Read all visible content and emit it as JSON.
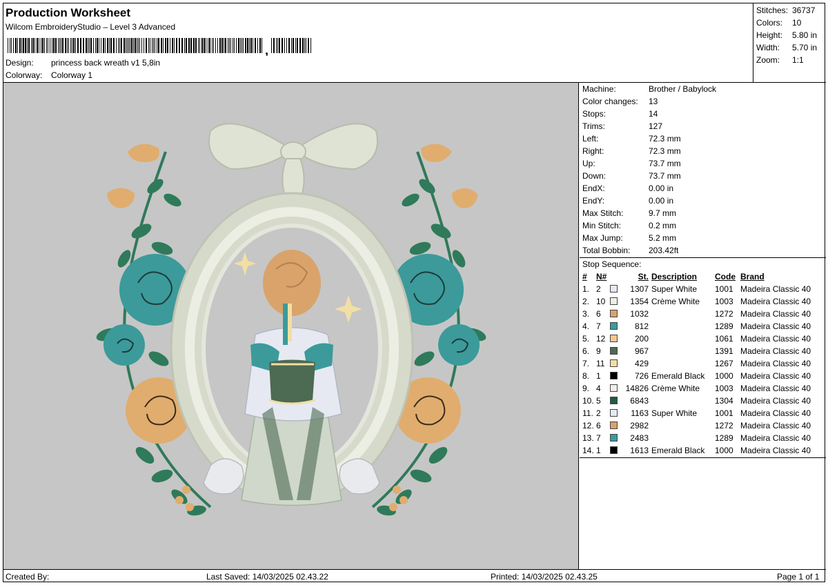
{
  "header": {
    "title": "Production Worksheet",
    "software": "Wilcom EmbroideryStudio – Level 3 Advanced",
    "barcode_tail": ",",
    "design_label": "Design:",
    "design_value": "princess back wreath v1 5,8in",
    "colorway_label": "Colorway:",
    "colorway_value": "Colorway 1"
  },
  "stats": [
    {
      "label": "Stitches:",
      "value": "36737"
    },
    {
      "label": "Colors:",
      "value": "10"
    },
    {
      "label": "Height:",
      "value": "5.80 in"
    },
    {
      "label": "Width:",
      "value": "5.70 in"
    },
    {
      "label": "Zoom:",
      "value": "1:1"
    }
  ],
  "machine_info": [
    {
      "label": "Machine:",
      "value": "Brother / Babylock"
    },
    {
      "label": "Color changes:",
      "value": "13"
    },
    {
      "label": "Stops:",
      "value": "14"
    },
    {
      "label": "Trims:",
      "value": "127"
    },
    {
      "label": "Left:",
      "value": "72.3 mm"
    },
    {
      "label": "Right:",
      "value": "72.3 mm"
    },
    {
      "label": "Up:",
      "value": "73.7 mm"
    },
    {
      "label": "Down:",
      "value": "73.7 mm"
    },
    {
      "label": "EndX:",
      "value": "0.00 in"
    },
    {
      "label": "EndY:",
      "value": "0.00 in"
    },
    {
      "label": "Max Stitch:",
      "value": "9.7 mm"
    },
    {
      "label": "Min Stitch:",
      "value": "0.2 mm"
    },
    {
      "label": "Max Jump:",
      "value": "5.2 mm"
    },
    {
      "label": "Total Bobbin:",
      "value": "203.42ft"
    }
  ],
  "stop_sequence": {
    "title": "Stop Sequence:",
    "headers": {
      "idx": "#",
      "num": "N#",
      "stitches": "St.",
      "description": "Description",
      "code": "Code",
      "brand": "Brand"
    },
    "rows": [
      {
        "idx": "1.",
        "num": "2",
        "color": "#e6e8f2",
        "stitches": "1307",
        "description": "Super White",
        "code": "1001",
        "brand": "Madeira Classic 40"
      },
      {
        "idx": "2.",
        "num": "10",
        "color": "#eeeee6",
        "stitches": "1354",
        "description": "Crème White",
        "code": "1003",
        "brand": "Madeira Classic 40"
      },
      {
        "idx": "3.",
        "num": "6",
        "color": "#d9a36b",
        "stitches": "1032",
        "description": "",
        "code": "1272",
        "brand": "Madeira Classic 40"
      },
      {
        "idx": "4.",
        "num": "7",
        "color": "#3c9a9a",
        "stitches": "812",
        "description": "",
        "code": "1289",
        "brand": "Madeira Classic 40"
      },
      {
        "idx": "5.",
        "num": "12",
        "color": "#f2c890",
        "stitches": "200",
        "description": "",
        "code": "1061",
        "brand": "Madeira Classic 40"
      },
      {
        "idx": "6.",
        "num": "9",
        "color": "#4d6a52",
        "stitches": "967",
        "description": "",
        "code": "1391",
        "brand": "Madeira Classic 40"
      },
      {
        "idx": "7.",
        "num": "11",
        "color": "#f2dfa4",
        "stitches": "429",
        "description": "",
        "code": "1267",
        "brand": "Madeira Classic 40"
      },
      {
        "idx": "8.",
        "num": "1",
        "color": "#000000",
        "stitches": "726",
        "description": "Emerald Black",
        "code": "1000",
        "brand": "Madeira Classic 40"
      },
      {
        "idx": "9.",
        "num": "4",
        "color": "#eeeee6",
        "stitches": "14826",
        "description": "Crème White",
        "code": "1003",
        "brand": "Madeira Classic 40"
      },
      {
        "idx": "10.",
        "num": "5",
        "color": "#1e5a44",
        "stitches": "6843",
        "description": "",
        "code": "1304",
        "brand": "Madeira Classic 40"
      },
      {
        "idx": "11.",
        "num": "2",
        "color": "#e6e8f2",
        "stitches": "1163",
        "description": "Super White",
        "code": "1001",
        "brand": "Madeira Classic 40"
      },
      {
        "idx": "12.",
        "num": "6",
        "color": "#d9a36b",
        "stitches": "2982",
        "description": "",
        "code": "1272",
        "brand": "Madeira Classic 40"
      },
      {
        "idx": "13.",
        "num": "7",
        "color": "#3c9a9a",
        "stitches": "2483",
        "description": "",
        "code": "1289",
        "brand": "Madeira Classic 40"
      },
      {
        "idx": "14.",
        "num": "1",
        "color": "#000000",
        "stitches": "1613",
        "description": "Emerald Black",
        "code": "1000",
        "brand": "Madeira Classic 40"
      }
    ]
  },
  "footer": {
    "created_by": "Created By:",
    "last_saved": "Last Saved: 14/03/2025 02.43.22",
    "printed": "Printed: 14/03/2025 02.43.25",
    "page": "Page 1 of 1"
  },
  "colors": {
    "canvas_bg": "#c6c6c6",
    "leaf_green": "#2f7a5a",
    "rose_teal": "#3c9a9a",
    "rose_peach": "#e0ad6e",
    "frame_cream": "#dfe3d3",
    "bodice_green": "#4d6a52"
  }
}
